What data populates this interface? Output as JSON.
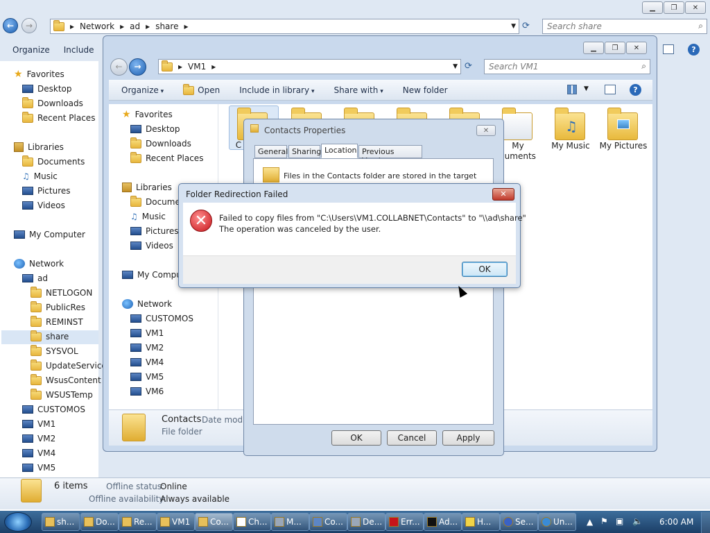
{
  "background_window": {
    "address": {
      "crumbs": [
        "Network",
        "ad",
        "share"
      ]
    },
    "search_placeholder": "Search share",
    "toolbar": {
      "organize": "Organize",
      "include": "Include"
    },
    "nav": {
      "favorites": "Favorites",
      "favorites_items": [
        "Desktop",
        "Downloads",
        "Recent Places"
      ],
      "libraries": "Libraries",
      "libraries_items": [
        "Documents",
        "Music",
        "Pictures",
        "Videos"
      ],
      "computer": "My Computer",
      "network": "Network",
      "ad": "ad",
      "ad_items": [
        "NETLOGON",
        "PublicRes",
        "REMINST",
        "share",
        "SYSVOL",
        "UpdateServices",
        "WsusContent",
        "WSUSTemp"
      ],
      "network_items": [
        "CUSTOMOS",
        "VM1",
        "VM2",
        "VM4",
        "VM5"
      ]
    },
    "details": {
      "count": "6 items",
      "offline_status_label": "Offline status:",
      "offline_status": "Online",
      "offline_avail_label": "Offline availability:",
      "offline_avail": "Always available"
    }
  },
  "vm1_window": {
    "address": {
      "crumbs": [
        "VM1"
      ]
    },
    "search_placeholder": "Search VM1",
    "toolbar": {
      "organize": "Organize",
      "open": "Open",
      "include": "Include in library",
      "share": "Share with",
      "new_folder": "New folder"
    },
    "nav": {
      "favorites": "Favorites",
      "favorites_items": [
        "Desktop",
        "Downloads",
        "Recent Places"
      ],
      "libraries": "Libraries",
      "libraries_items": [
        "Documer",
        "Music",
        "Pictures",
        "Videos"
      ],
      "computer": "My Compu",
      "network": "Network",
      "network_items": [
        "CUSTOMOS",
        "VM1",
        "VM2",
        "VM4",
        "VM5",
        "VM6"
      ]
    },
    "folders_partial": [
      "C"
    ],
    "folders": [
      "My\ncuments",
      "My Music",
      "My Pictures"
    ],
    "details": {
      "name": "Contacts",
      "date_label": "Date modif",
      "type": "File folder"
    }
  },
  "properties_dialog": {
    "title": "Contacts Properties",
    "tabs": [
      "General",
      "Sharing",
      "Location",
      "Previous Versions"
    ],
    "body_text": "Files in the Contacts folder are stored in the target",
    "buttons": {
      "ok": "OK",
      "cancel": "Cancel",
      "apply": "Apply"
    }
  },
  "error_dialog": {
    "title": "Folder Redirection Failed",
    "message_line1": "Failed to copy files from \"C:\\Users\\VM1.COLLABNET\\Contacts\" to \"\\\\ad\\share\"",
    "message_line2": "The operation was canceled by the user.",
    "ok": "OK"
  },
  "taskbar": {
    "tasks": [
      "sh...",
      "Do...",
      "Re...",
      "VM1",
      "Co...",
      "Ch...",
      "M...",
      "Co...",
      "De...",
      "Err...",
      "Ad...",
      "H...",
      "Se...",
      "Un..."
    ],
    "time": "6:00 AM"
  }
}
